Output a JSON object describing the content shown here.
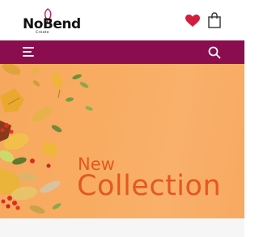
{
  "header": {
    "logo_text": "NoBend",
    "logo_subtext": "Create",
    "icons": {
      "wishlist": "heart-icon",
      "cart": "shopping-bag-icon",
      "menu": "hamburger-menu-icon",
      "search": "search-icon"
    }
  },
  "hero": {
    "line1": "New",
    "line2": "Collection"
  },
  "colors": {
    "brand": "#8a0d4f",
    "heart": "#d21e3c",
    "hero_background": "#f8ac62",
    "hero_text": "#e4581f"
  }
}
